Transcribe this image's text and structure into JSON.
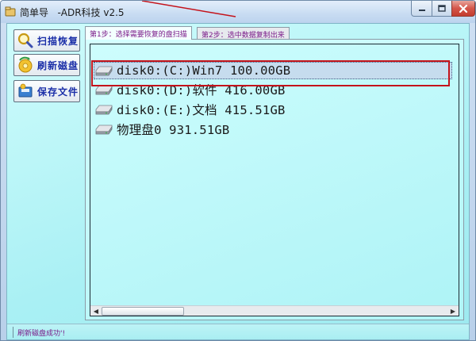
{
  "window": {
    "title": "简单导   -ADR科技 v2.5",
    "controls": {
      "minimize": "minimize",
      "maximize": "maximize",
      "close": "close"
    }
  },
  "sidebar": {
    "buttons": [
      {
        "label": "扫描恢复",
        "icon": "magnifier-icon"
      },
      {
        "label": "刷新磁盘",
        "icon": "refresh-disc-icon"
      },
      {
        "label": "保存文件",
        "icon": "save-file-icon"
      }
    ]
  },
  "tabs": [
    {
      "label": "第1步：选择需要恢复的盘扫描",
      "active": true
    },
    {
      "label": "第2步：选中数据复制出来",
      "active": false
    }
  ],
  "disk_list": {
    "items": [
      {
        "text": "disk0:(C:)Win7 100.00GB",
        "selected": true,
        "icon": "hard-disk-icon"
      },
      {
        "text": "disk0:(D:)软件 416.00GB",
        "selected": false,
        "icon": "hard-disk-icon"
      },
      {
        "text": "disk0:(E:)文档 415.51GB",
        "selected": false,
        "icon": "hard-disk-icon"
      },
      {
        "text": "物理盘0 931.51GB",
        "selected": false,
        "icon": "hard-disk-icon"
      }
    ]
  },
  "status": {
    "text": "刷新磁盘成功'!"
  },
  "colors": {
    "client_bg": "#a9f0f4",
    "button_label": "#1b2fa8",
    "tab_text": "#7a1a88",
    "highlight_outline": "#c4131b",
    "close_button": "#c43c2e"
  }
}
